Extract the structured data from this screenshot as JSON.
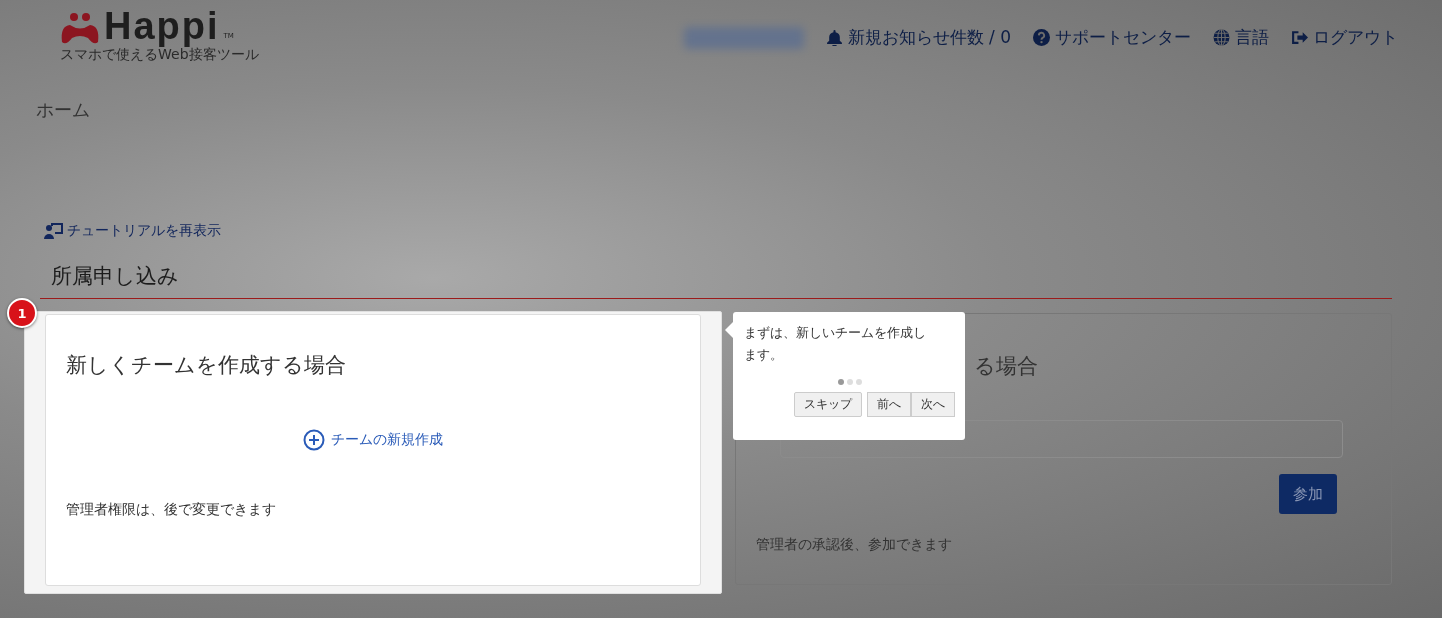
{
  "header": {
    "logo": {
      "name": "Happi",
      "tm": "TM",
      "tagline": "スマホで使えるWeb接客ツール"
    },
    "nav": [
      {
        "kind": "user"
      },
      {
        "kind": "bell",
        "label": "新規お知らせ件数 / 0"
      },
      {
        "kind": "help",
        "label": "サポートセンター"
      },
      {
        "kind": "globe",
        "label": "言語"
      },
      {
        "kind": "logout",
        "label": "ログアウト"
      }
    ]
  },
  "breadcrumb": "ホーム",
  "tutorial_link": "チュートリアルを再表示",
  "section_title": "所属申し込み",
  "cards": [
    {
      "kind": "create",
      "title": "新しくチームを作成する場合",
      "action": "チームの新規作成",
      "note": "管理者権限は、後で変更できます",
      "highlighted": true
    },
    {
      "kind": "join",
      "title": "る場合",
      "button": "参加",
      "note": "管理者の承認後、参加できます",
      "highlighted": false
    }
  ],
  "tour": {
    "step": "1",
    "text": "まずは、新しいチームを作成します。",
    "dots": [
      {
        "selected": true
      },
      {
        "selected": false
      },
      {
        "selected": false
      }
    ],
    "buttons": [
      {
        "kind": "skip",
        "label": "スキップ"
      },
      {
        "kind": "prev",
        "label": "前へ"
      },
      {
        "kind": "next",
        "label": "次へ"
      }
    ]
  }
}
